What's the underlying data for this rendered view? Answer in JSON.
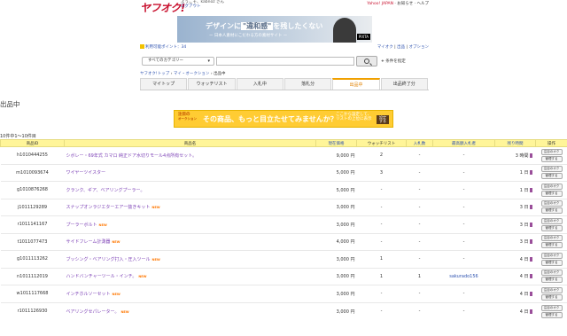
{
  "header": {
    "logo": "ヤフオク!",
    "greeting_line1": "ようこそ、kabnoz さん",
    "greeting_line2": "ログアウト",
    "links": [
      "Yahoo! JAPAN",
      "お知らせ",
      "ヘルプ"
    ]
  },
  "subbar": {
    "points": "利用可能ポイント：34",
    "account": [
      "マイオク",
      "出品",
      "オプション"
    ]
  },
  "banner": {
    "line1_pre": "デザインに",
    "line1_hl": "\"違和感\"",
    "line1_post": "を残したくない",
    "line2": "ー 日本人素材にこだわる方の素材サイト ー",
    "brand": "PIXTA"
  },
  "search": {
    "category": "すべてのカテゴリー",
    "condition_label": "条件を指定"
  },
  "breadcrumb": [
    "ヤフオク!トップ",
    "マイ・オークション",
    "出品中"
  ],
  "tabs": [
    {
      "label": "マイトップ",
      "active": false
    },
    {
      "label": "ウォッチリスト",
      "active": false
    },
    {
      "label": "入札中",
      "active": false
    },
    {
      "label": "落札分",
      "active": false
    },
    {
      "label": "出品中",
      "active": true
    },
    {
      "label": "出品終了分",
      "active": false
    }
  ],
  "page_title": "出品中",
  "promo": {
    "tag_line1": "注目の",
    "tag_line2": "オークション",
    "headline": "その商品、もっと目立たせてみませんか？",
    "side_text": "ここから設定して、リストの上位に表示",
    "button_line1": "設定",
    "button_line2": "する"
  },
  "result_count": "10件中1〜10件目",
  "table": {
    "headers": {
      "id": "商品ID",
      "name": "商品名",
      "price": "現在価格",
      "watch": "ウォッチリスト",
      "bids": "入札数",
      "bidder": "最高額入札者",
      "time": "残り時間",
      "ops": "操作"
    },
    "op_buttons": [
      "注目のオク",
      "管理する"
    ],
    "rows": [
      {
        "id": "h1010444255",
        "name": "シボレー・69年式 カマロ 純正ドア水切りモール4点所有セット。",
        "new": false,
        "price": "9,000 円",
        "watch": "2",
        "bids": "-",
        "bidder": "-",
        "time": "3 時間"
      },
      {
        "id": "m1010093674",
        "name": "ワイヤーツイスター",
        "new": false,
        "price": "5,000 円",
        "watch": "3",
        "bids": "-",
        "bidder": "-",
        "time": "1 日"
      },
      {
        "id": "g1010876268",
        "name": "クランク、ギア、ベアリングプーラー。",
        "new": false,
        "price": "5,000 円",
        "watch": "-",
        "bids": "-",
        "bidder": "-",
        "time": "1 日"
      },
      {
        "id": "j1011129289",
        "name": "スナップオンラジエターエア一抜きキット",
        "new": true,
        "price": "3,000 円",
        "watch": "-",
        "bids": "-",
        "bidder": "-",
        "time": "3 日"
      },
      {
        "id": "r1011141167",
        "name": "プーラーボルト",
        "new": true,
        "price": "3,000 円",
        "watch": "-",
        "bids": "-",
        "bidder": "-",
        "time": "3 日"
      },
      {
        "id": "t1011077473",
        "name": "サイドフレーム計測器",
        "new": true,
        "price": "4,000 円",
        "watch": "-",
        "bids": "-",
        "bidder": "-",
        "time": "3 日"
      },
      {
        "id": "g1011113262",
        "name": "ブッシング・ベアリング打入・圧入ツール",
        "new": true,
        "price": "3,000 円",
        "watch": "1",
        "bids": "-",
        "bidder": "-",
        "time": "4 日"
      },
      {
        "id": "n1011112019",
        "name": "ハンドバンチャーツール・インチ。",
        "new": true,
        "price": "3,000 円",
        "watch": "1",
        "bids": "1",
        "bidder": "sakurado156",
        "time": "4 日"
      },
      {
        "id": "w1011117668",
        "name": "インチホルソーセット",
        "new": true,
        "price": "3,000 円",
        "watch": "-",
        "bids": "-",
        "bidder": "-",
        "time": "4 日"
      },
      {
        "id": "r1011126930",
        "name": "ベアリングセパレーター。",
        "new": true,
        "price": "3,000 円",
        "watch": "-",
        "bids": "-",
        "bidder": "-",
        "time": "4 日"
      }
    ]
  },
  "icons": {
    "time": "hourglass-icon",
    "search": "search-icon",
    "points": "point-coin-icon"
  },
  "colors": {
    "accent": "#f0a000",
    "header_row": "#fff599",
    "link": "#2f53b0",
    "item_link": "#7b3fb5",
    "new_badge": "#ff7700"
  }
}
